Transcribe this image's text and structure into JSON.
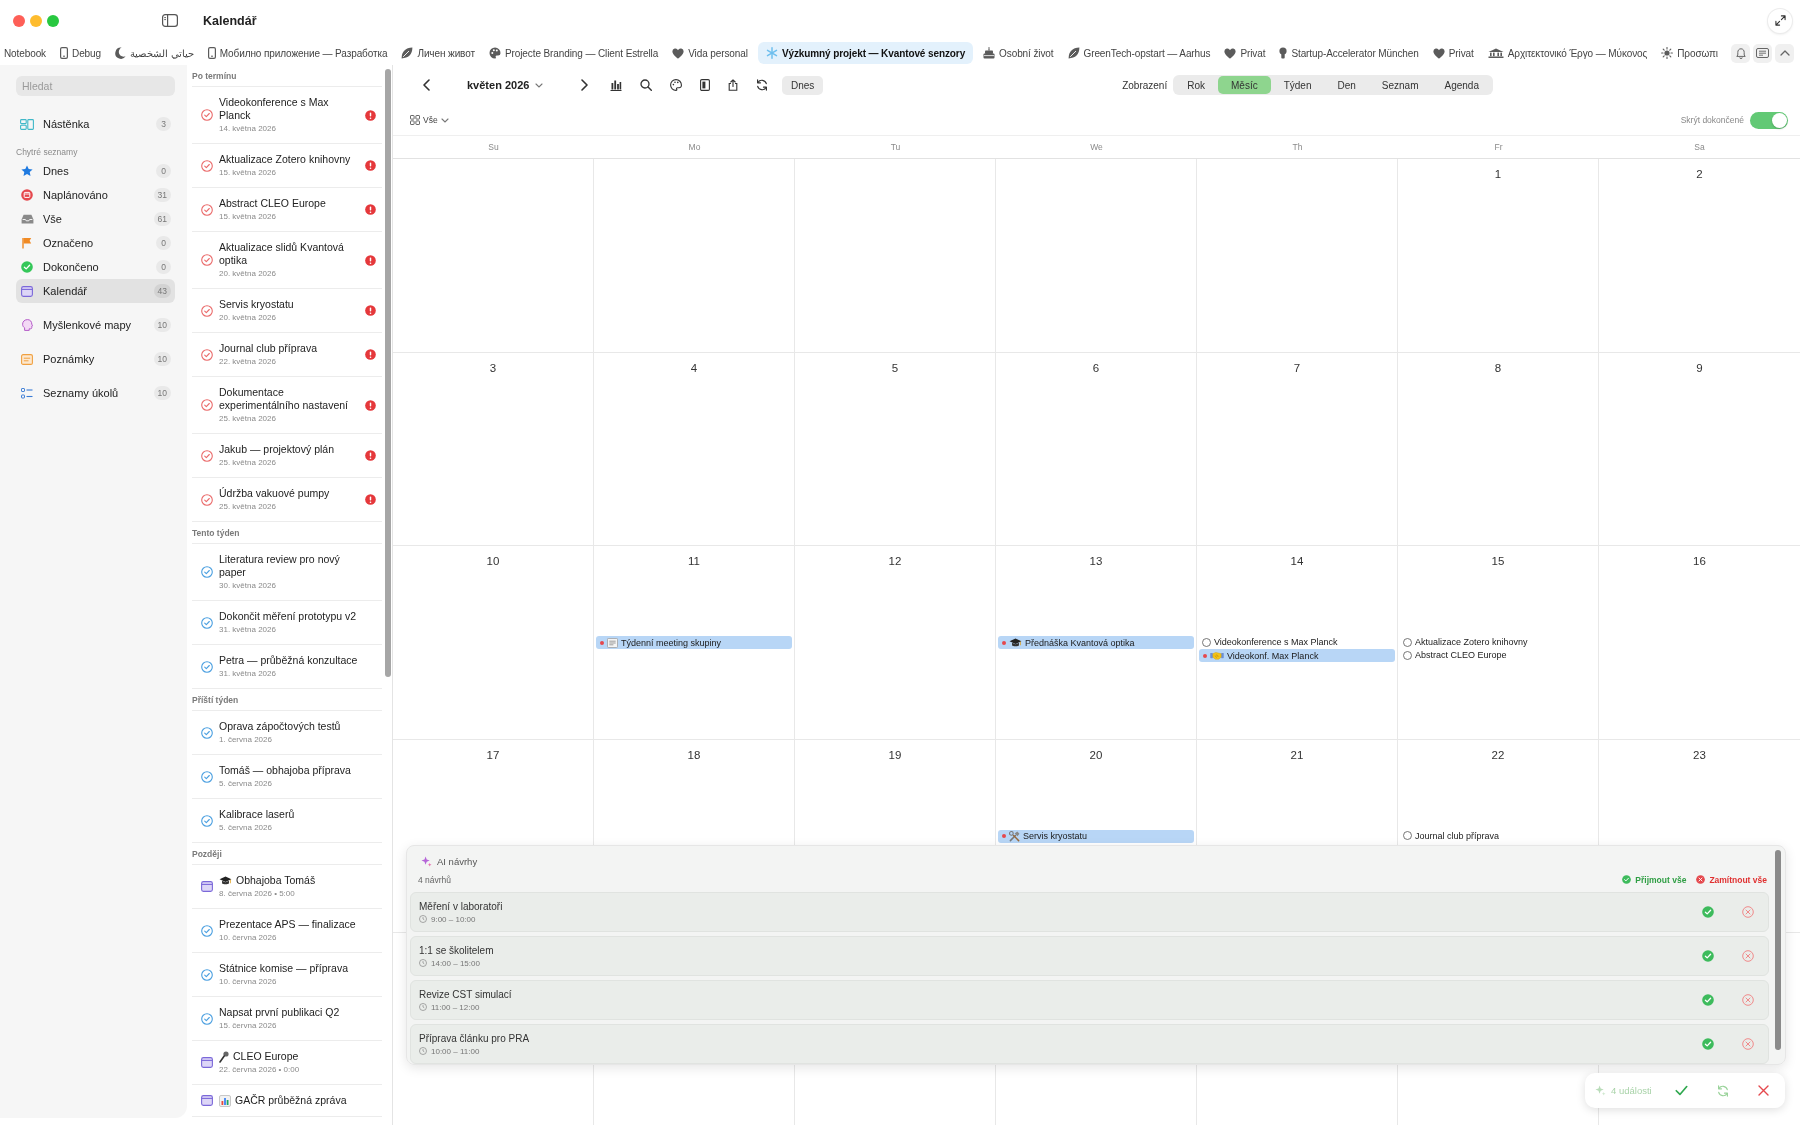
{
  "window": {
    "title": "Kalendář"
  },
  "tabs": [
    {
      "label": "Notebook",
      "selected": false
    },
    {
      "label": "Debug",
      "selected": false
    },
    {
      "label": "حياتي الشخصية",
      "selected": false
    },
    {
      "label": "Мобилно приложение — Разработка",
      "selected": false
    },
    {
      "label": "Личен живот",
      "selected": false
    },
    {
      "label": "Projecte Branding — Client Estrella",
      "selected": false
    },
    {
      "label": "Vida personal",
      "selected": false
    },
    {
      "label": "Výzkumný projekt — Kvantové senzory",
      "selected": true
    },
    {
      "label": "Osobní život",
      "selected": false
    },
    {
      "label": "GreenTech-opstart — Aarhus",
      "selected": false
    },
    {
      "label": "Privat",
      "selected": false
    },
    {
      "label": "Startup-Accelerator München",
      "selected": false
    },
    {
      "label": "Privat",
      "selected": false
    },
    {
      "label": "Αρχιτεκτονικό Έργο — Μύκονος",
      "selected": false
    },
    {
      "label": "Προσωπι",
      "selected": false
    }
  ],
  "sidebar": {
    "search": {
      "placeholder": "Hledat"
    },
    "groups": [
      {
        "items": [
          {
            "label": "Nástěnka",
            "count": "3",
            "selected": false
          }
        ]
      },
      {
        "title": "Chytré seznamy",
        "items": [
          {
            "label": "Dnes",
            "count": "0",
            "selected": false
          },
          {
            "label": "Naplánováno",
            "count": "31",
            "selected": false
          },
          {
            "label": "Vše",
            "count": "61",
            "selected": false
          },
          {
            "label": "Označeno",
            "count": "0",
            "selected": false
          },
          {
            "label": "Dokončeno",
            "count": "0",
            "selected": false
          },
          {
            "label": "Kalendář",
            "count": "43",
            "selected": true
          }
        ]
      },
      {
        "items": [
          {
            "label": "Myšlenkové mapy",
            "count": "10",
            "selected": false
          }
        ]
      },
      {
        "items": [
          {
            "label": "Poznámky",
            "count": "10",
            "selected": false
          }
        ]
      },
      {
        "items": [
          {
            "label": "Seznamy úkolů",
            "count": "10",
            "selected": false
          }
        ]
      }
    ]
  },
  "task_list": {
    "sections": [
      {
        "title": "Po termínu",
        "items": [
          {
            "kind": "overdue",
            "title": "Videokonference s Max Planck",
            "date": "14. května 2026",
            "high_priority": true
          },
          {
            "kind": "overdue",
            "title": "Aktualizace Zotero knihovny",
            "date": "15. května 2026",
            "high_priority": true
          },
          {
            "kind": "overdue",
            "title": "Abstract CLEO Europe",
            "date": "15. května 2026",
            "high_priority": true
          },
          {
            "kind": "overdue",
            "title": "Aktualizace slidů Kvantová optika",
            "date": "20. května 2026",
            "high_priority": true
          },
          {
            "kind": "overdue",
            "title": "Servis kryostatu",
            "date": "20. května 2026",
            "high_priority": true
          },
          {
            "kind": "overdue",
            "title": "Journal club příprava",
            "date": "22. května 2026",
            "high_priority": true
          },
          {
            "kind": "overdue",
            "title": "Dokumentace experimentálního nastavení",
            "date": "25. května 2026",
            "high_priority": true
          },
          {
            "kind": "overdue",
            "title": "Jakub — projektový plán",
            "date": "25. května 2026",
            "high_priority": true
          },
          {
            "kind": "overdue",
            "title": "Údržba vakuové pumpy",
            "date": "25. května 2026",
            "high_priority": true
          }
        ]
      },
      {
        "title": "Tento týden",
        "items": [
          {
            "kind": "upcoming",
            "title": "Literatura review pro nový paper",
            "date": "30. května 2026",
            "high_priority": false
          },
          {
            "kind": "upcoming",
            "title": "Dokončit měření prototypu v2",
            "date": "31. května 2026",
            "high_priority": false
          },
          {
            "kind": "upcoming",
            "title": "Petra — průběžná konzultace",
            "date": "31. května 2026",
            "high_priority": false
          }
        ]
      },
      {
        "title": "Příští týden",
        "items": [
          {
            "kind": "upcoming",
            "title": "Oprava zápočtových testů",
            "date": "1. června 2026",
            "high_priority": false
          },
          {
            "kind": "upcoming",
            "title": "Tomáš — obhajoba příprava",
            "date": "5. června 2026",
            "high_priority": false
          },
          {
            "kind": "upcoming",
            "title": "Kalibrace laserů",
            "date": "5. června 2026",
            "high_priority": false
          }
        ]
      },
      {
        "title": "Později",
        "items": [
          {
            "kind": "event",
            "title": "Obhajoba Tomáš",
            "date": "8. června 2026 • 5:00",
            "high_priority": false
          },
          {
            "kind": "upcoming",
            "title": "Prezentace APS — finalizace",
            "date": "10. června 2026",
            "high_priority": false
          },
          {
            "kind": "upcoming",
            "title": "Státnice komise — příprava",
            "date": "10. června 2026",
            "high_priority": false
          },
          {
            "kind": "upcoming",
            "title": "Napsat první publikaci Q2",
            "date": "15. června 2026",
            "high_priority": false
          },
          {
            "kind": "event",
            "title": "CLEO Europe",
            "date": "22. června 2026 • 0:00",
            "high_priority": false
          },
          {
            "kind": "event",
            "title": "GAČR průběžná zpráva",
            "high_priority": false
          }
        ]
      }
    ]
  },
  "calendar": {
    "month": "květen 2026",
    "today_button": "Dnes",
    "view_label": "Zobrazení",
    "views": [
      {
        "label": "Rok",
        "selected": false
      },
      {
        "label": "Měsíc",
        "selected": true
      },
      {
        "label": "Týden",
        "selected": false
      },
      {
        "label": "Den",
        "selected": false
      },
      {
        "label": "Seznam",
        "selected": false
      },
      {
        "label": "Agenda",
        "selected": false
      }
    ],
    "filter": "Vše",
    "hide_completed": {
      "label": "Skrýt dokončené",
      "on": true
    },
    "weekdays": [
      "Su",
      "Mo",
      "Tu",
      "We",
      "Th",
      "Fr",
      "Sa"
    ],
    "weeks": [
      {
        "days": [
          {
            "date": "1"
          },
          {
            "date": "2"
          }
        ]
      },
      {
        "days": [
          {
            "date": "3"
          },
          {
            "date": "4"
          },
          {
            "date": "5"
          },
          {
            "date": "6"
          },
          {
            "date": "7"
          },
          {
            "date": "8"
          },
          {
            "date": "9"
          }
        ]
      },
      {
        "days": [
          {
            "date": "10"
          },
          {
            "date": "11",
            "items": [
              {
                "kind": "event",
                "title": "Týdenní meeting skupiny"
              }
            ]
          },
          {
            "date": "12"
          },
          {
            "date": "13",
            "items": [
              {
                "kind": "event",
                "title": "Přednáška Kvantová optika"
              }
            ]
          },
          {
            "date": "14",
            "items": [
              {
                "kind": "task",
                "title": "Videokonference s Max Planck"
              },
              {
                "kind": "event",
                "title": "Videokonf. Max Planck"
              }
            ]
          },
          {
            "date": "15",
            "items": [
              {
                "kind": "task",
                "title": "Aktualizace Zotero knihovny"
              },
              {
                "kind": "task",
                "title": "Abstract CLEO Europe"
              }
            ]
          },
          {
            "date": "16"
          }
        ]
      },
      {
        "days": [
          {
            "date": "17"
          },
          {
            "date": "18"
          },
          {
            "date": "19"
          },
          {
            "date": "20",
            "items": [
              {
                "kind": "event",
                "title": "Servis kryostatu"
              }
            ]
          },
          {
            "date": "21"
          },
          {
            "date": "22",
            "items": [
              {
                "kind": "task",
                "title": "Journal club příprava"
              }
            ]
          },
          {
            "date": "23"
          }
        ]
      }
    ]
  },
  "ai_suggestions": {
    "title": "AI návrhy",
    "count": "4 návrhů",
    "accept_all": "Přijmout vše",
    "reject_all": "Zamítnout vše",
    "items": [
      {
        "title": "Měření v laboratoři",
        "time": "9:00 – 10:00"
      },
      {
        "title": "1:1 se školitelem",
        "time": "14:00 – 15:00"
      },
      {
        "title": "Revize CST simulací",
        "time": "11:00 – 12:00"
      },
      {
        "title": "Příprava článku pro PRA",
        "time": "10:00 – 11:00"
      }
    ]
  },
  "action_bar": {
    "count": "4 události"
  }
}
